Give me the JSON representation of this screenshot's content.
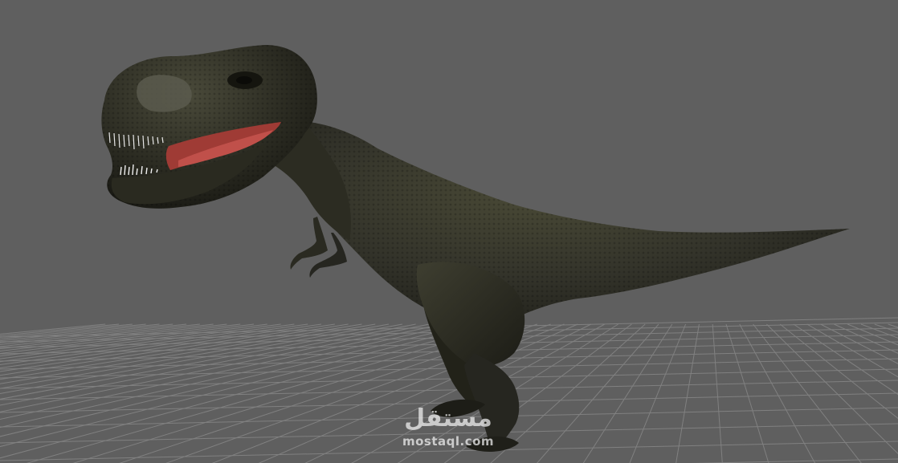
{
  "viewport": {
    "background_color": "#5f5f5f",
    "grid_line_color": "#8c8c8c"
  },
  "model": {
    "skin_color": "#2f2f22",
    "mouth_color": "#c0504a",
    "teeth_color": "#e8e8e8"
  },
  "watermark": {
    "arabic": "مستقل",
    "latin": "mostaql.com",
    "color": "#f4f4f4"
  }
}
